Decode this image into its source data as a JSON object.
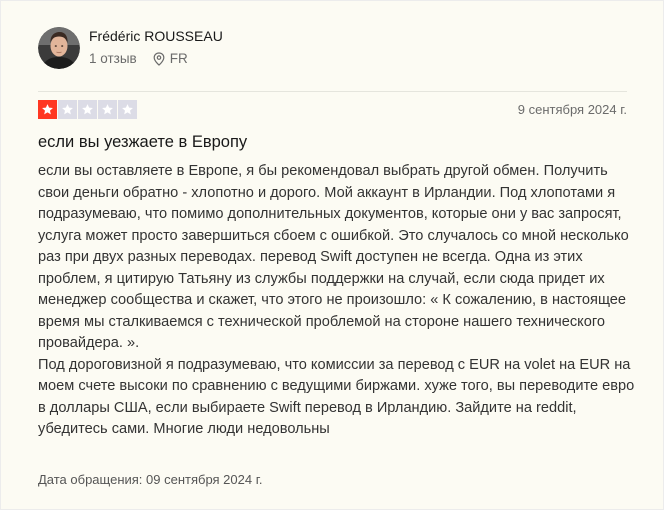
{
  "reviewer": {
    "name": "Frédéric ROUSSEAU",
    "review_count": "1 отзыв",
    "country": "FR",
    "avatar_icon": "avatar-photo"
  },
  "review": {
    "rating": 1,
    "max_rating": 5,
    "filled_star_color": "#ff3722",
    "empty_star_color": "#dcdce6",
    "date": "9 сентября 2024 г.",
    "title": "если вы уезжаете в Европу",
    "body_paragraphs": [
      "если вы оставляете в Европе, я бы рекомендовал выбрать другой обмен. Получить свои деньги обратно - хлопотно и дорого. Мой аккаунт в Ирландии. Под хлопотами я подразумеваю, что помимо дополнительных документов, которые они у вас запросят, услуга может просто завершиться сбоем с ошибкой. Это случалось со мной несколько раз при двух разных переводах. перевод Swift доступен не всегда. Одна из этих проблем, я цитирую Татьяну из службы поддержки на случай, если сюда придет их менеджер сообщества и скажет, что этого не произошло: « К сожалению, в настоящее время мы сталкиваемся с технической проблемой на стороне нашего технического провайдера. ».",
      "Под дороговизной я подразумеваю, что комиссии за перевод с EUR на volet на EUR на моем счете высоки по сравнению с ведущими биржами. хуже того, вы переводите евро в доллары США, если выбираете Swift перевод в Ирландию. Зайдите на reddit, убедитесь сами. Многие люди недовольны"
    ],
    "experience_date": "Дата обращения: 09 сентября 2024 г."
  }
}
